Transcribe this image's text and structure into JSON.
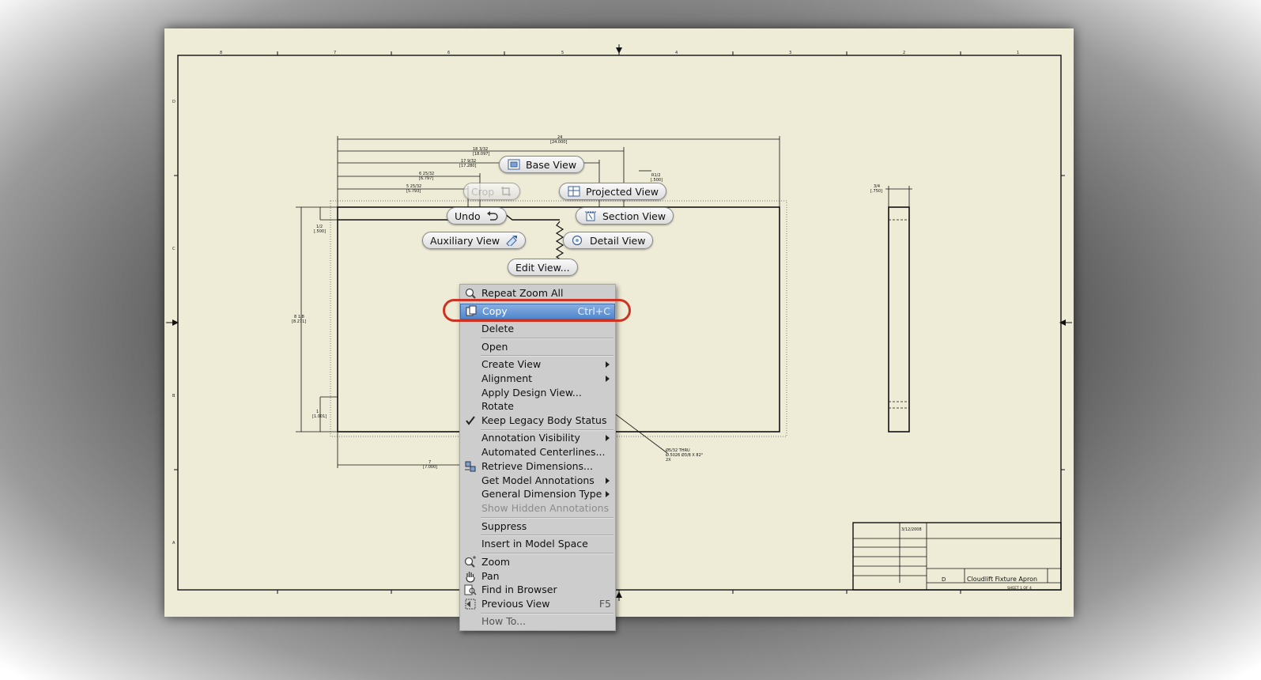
{
  "marking_menu": {
    "base_view": "Base View",
    "projected_view": "Projected View",
    "crop": "Crop",
    "undo": "Undo",
    "section_view": "Section View",
    "auxiliary_view": "Auxiliary View",
    "detail_view": "Detail View",
    "edit_view": "Edit View..."
  },
  "context_menu": {
    "items": [
      {
        "label": "Repeat Zoom All"
      },
      {
        "label": "Copy",
        "shortcut": "Ctrl+C"
      },
      {
        "label": "Delete"
      },
      {
        "label": "Open"
      },
      {
        "label": "Create View"
      },
      {
        "label": "Alignment"
      },
      {
        "label": "Apply Design View..."
      },
      {
        "label": "Rotate"
      },
      {
        "label": "Keep Legacy Body Status"
      },
      {
        "label": "Annotation Visibility"
      },
      {
        "label": "Automated Centerlines..."
      },
      {
        "label": "Retrieve Dimensions..."
      },
      {
        "label": "Get Model Annotations"
      },
      {
        "label": "General Dimension Type"
      },
      {
        "label": "Show Hidden Annotations"
      },
      {
        "label": "Suppress"
      },
      {
        "label": "Insert in Model Space"
      },
      {
        "label": "Zoom"
      },
      {
        "label": "Pan"
      },
      {
        "label": "Find in Browser"
      },
      {
        "label": "Previous View",
        "shortcut": "F5"
      },
      {
        "label": "How To..."
      }
    ]
  },
  "title_block": {
    "date": "3/12/2008",
    "size": "D",
    "drawing_title": "Cloudlift Fixture Apron",
    "sheet": "SHEET 1 OF 4"
  },
  "dimensions": {
    "overall": "24",
    "overall_metric": "[24.000]",
    "d1": "18 3/32",
    "d1m": "[18.097]",
    "d2": "17 9/32",
    "d2m": "[17.280]",
    "d3": "6 25/32",
    "d3m": "[6.797]",
    "d4": "5 25/32",
    "d4m": "[5.793]",
    "half": "1/2",
    "half_m": "[.500]",
    "height": "8 1/8",
    "height_m": "[8.271]",
    "one": "1",
    "one_m": "[1.001]",
    "seven": "7",
    "seven_m": "[7.000]",
    "radius": "R1/2",
    "radius_m": "[.500]",
    "quarter": "3/4",
    "quarter_m": "[.750]",
    "hole_note_1": "Ø5/32 THRU",
    "hole_note_2": "Ø.5026 Ø3/8 X 82°",
    "hole_note_3": "2X"
  },
  "border_zones": {
    "top": [
      "8",
      "7",
      "6",
      "5",
      "4",
      "3",
      "2",
      "1"
    ],
    "side": [
      "D",
      "C",
      "B",
      "A"
    ]
  },
  "colors": {
    "sheet": "#eeecd6",
    "menu_bg": "#cdcdcd",
    "highlight": "#4f86cc",
    "callout": "#cc3322"
  }
}
